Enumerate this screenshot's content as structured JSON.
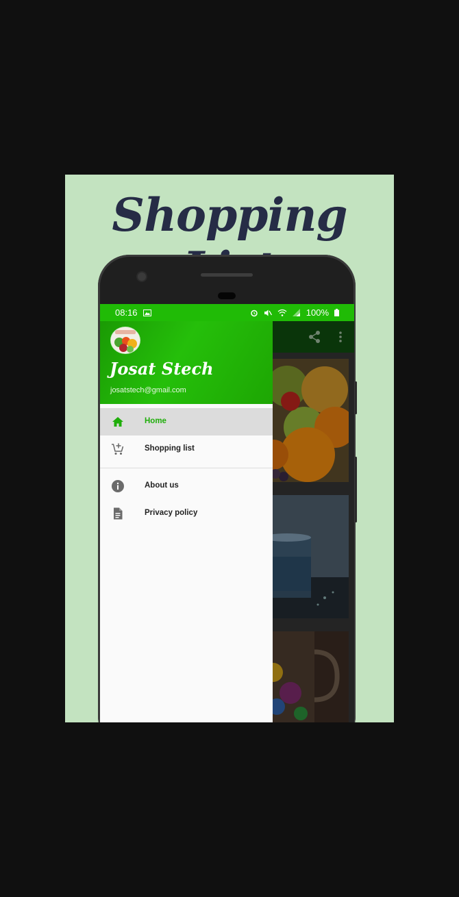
{
  "poster": {
    "title": "Shopping List"
  },
  "status_bar": {
    "time": "08:16",
    "battery": "100%"
  },
  "app_bar": {
    "icons": [
      "share-icon",
      "more-vert-icon"
    ]
  },
  "drawer": {
    "user_name": "Josat Stech",
    "email": "josatstech@gmail.com",
    "items": [
      {
        "label": "Home",
        "icon": "home-icon",
        "active": true
      },
      {
        "label": "Shopping list",
        "icon": "add-cart-icon",
        "active": false
      },
      {
        "label": "About us",
        "icon": "info-icon",
        "active": false
      },
      {
        "label": "Privacy policy",
        "icon": "document-icon",
        "active": false
      }
    ]
  },
  "colors": {
    "accent": "#20bb06",
    "poster_bg": "#c3e3c0",
    "title": "#262c46"
  }
}
